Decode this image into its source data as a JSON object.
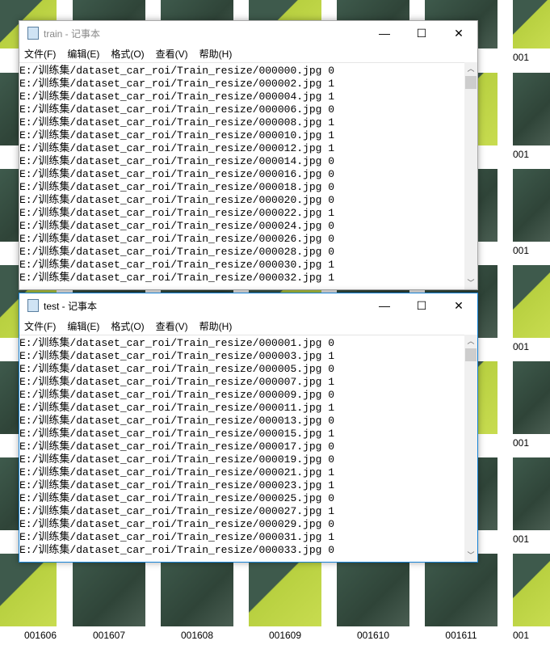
{
  "background": {
    "bottom_labels": [
      "001606",
      "001607",
      "001608",
      "001609",
      "001610",
      "001611",
      "001"
    ],
    "partial_label": "001"
  },
  "windows": [
    {
      "title": "train - 记事本",
      "active": false,
      "menu": [
        "文件(F)",
        "编辑(E)",
        "格式(O)",
        "查看(V)",
        "帮助(H)"
      ],
      "lines": [
        "E:/训练集/dataset_car_roi/Train_resize/000000.jpg 0",
        "E:/训练集/dataset_car_roi/Train_resize/000002.jpg 1",
        "E:/训练集/dataset_car_roi/Train_resize/000004.jpg 1",
        "E:/训练集/dataset_car_roi/Train_resize/000006.jpg 0",
        "E:/训练集/dataset_car_roi/Train_resize/000008.jpg 1",
        "E:/训练集/dataset_car_roi/Train_resize/000010.jpg 1",
        "E:/训练集/dataset_car_roi/Train_resize/000012.jpg 1",
        "E:/训练集/dataset_car_roi/Train_resize/000014.jpg 0",
        "E:/训练集/dataset_car_roi/Train_resize/000016.jpg 0",
        "E:/训练集/dataset_car_roi/Train_resize/000018.jpg 0",
        "E:/训练集/dataset_car_roi/Train_resize/000020.jpg 0",
        "E:/训练集/dataset_car_roi/Train_resize/000022.jpg 1",
        "E:/训练集/dataset_car_roi/Train_resize/000024.jpg 0",
        "E:/训练集/dataset_car_roi/Train_resize/000026.jpg 0",
        "E:/训练集/dataset_car_roi/Train_resize/000028.jpg 0",
        "E:/训练集/dataset_car_roi/Train_resize/000030.jpg 1",
        "E:/训练集/dataset_car_roi/Train_resize/000032.jpg 1"
      ]
    },
    {
      "title": "test - 记事本",
      "active": true,
      "menu": [
        "文件(F)",
        "编辑(E)",
        "格式(O)",
        "查看(V)",
        "帮助(H)"
      ],
      "lines": [
        "E:/训练集/dataset_car_roi/Train_resize/000001.jpg 0",
        "E:/训练集/dataset_car_roi/Train_resize/000003.jpg 1",
        "E:/训练集/dataset_car_roi/Train_resize/000005.jpg 0",
        "E:/训练集/dataset_car_roi/Train_resize/000007.jpg 1",
        "E:/训练集/dataset_car_roi/Train_resize/000009.jpg 0",
        "E:/训练集/dataset_car_roi/Train_resize/000011.jpg 1",
        "E:/训练集/dataset_car_roi/Train_resize/000013.jpg 0",
        "E:/训练集/dataset_car_roi/Train_resize/000015.jpg 1",
        "E:/训练集/dataset_car_roi/Train_resize/000017.jpg 0",
        "E:/训练集/dataset_car_roi/Train_resize/000019.jpg 0",
        "E:/训练集/dataset_car_roi/Train_resize/000021.jpg 1",
        "E:/训练集/dataset_car_roi/Train_resize/000023.jpg 1",
        "E:/训练集/dataset_car_roi/Train_resize/000025.jpg 0",
        "E:/训练集/dataset_car_roi/Train_resize/000027.jpg 1",
        "E:/训练集/dataset_car_roi/Train_resize/000029.jpg 0",
        "E:/训练集/dataset_car_roi/Train_resize/000031.jpg 1",
        "E:/训练集/dataset_car_roi/Train_resize/000033.jpg 0"
      ]
    }
  ],
  "controls": {
    "minimize": "—",
    "maximize": "☐",
    "close": "✕",
    "scroll_up": "︿",
    "scroll_down": "﹀"
  },
  "colors": {
    "active_border": "#1883d7"
  }
}
